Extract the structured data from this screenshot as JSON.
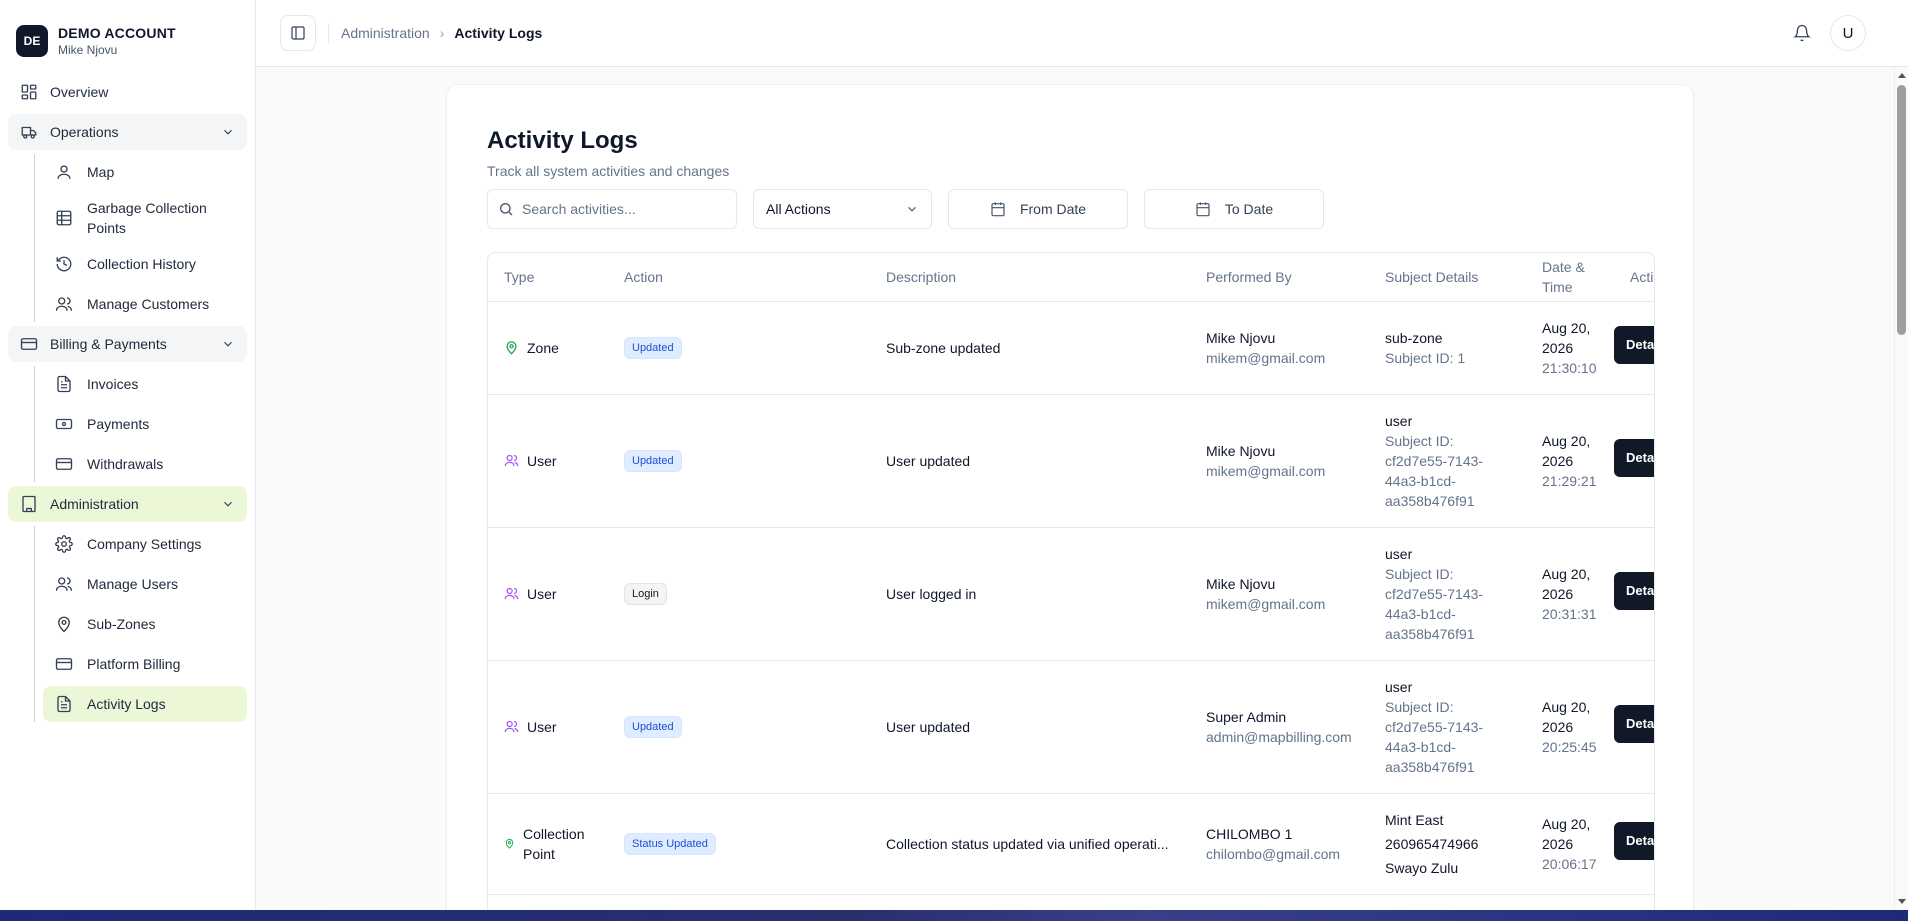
{
  "account": {
    "initials": "DE",
    "name": "DEMO ACCOUNT",
    "user": "Mike Njovu"
  },
  "nav": {
    "overview": "Overview",
    "operations": "Operations",
    "map": "Map",
    "gcp": "Garbage Collection Points",
    "collection_history": "Collection History",
    "manage_customers": "Manage Customers",
    "billing": "Billing & Payments",
    "invoices": "Invoices",
    "payments": "Payments",
    "withdrawals": "Withdrawals",
    "administration": "Administration",
    "company_settings": "Company Settings",
    "manage_users": "Manage Users",
    "sub_zones": "Sub-Zones",
    "platform_billing": "Platform Billing",
    "activity_logs": "Activity Logs"
  },
  "breadcrumb": {
    "parent": "Administration",
    "current": "Activity Logs"
  },
  "avatar": "U",
  "page": {
    "title": "Activity Logs",
    "subtitle": "Track all system activities and changes"
  },
  "filters": {
    "search_placeholder": "Search activities...",
    "actions_value": "All Actions",
    "from_date": "From Date",
    "to_date": "To Date"
  },
  "table": {
    "headers": {
      "type": "Type",
      "action": "Action",
      "description": "Description",
      "performed_by": "Performed By",
      "subject": "Subject Details",
      "datetime_1": "Date &",
      "datetime_2": "Time",
      "actions": "Actions"
    },
    "rows": [
      {
        "type": "Zone",
        "action": "Updated",
        "description": "Sub-zone updated",
        "name": "Mike Njovu",
        "email": "mikem@gmail.com",
        "subject_title": "sub-zone",
        "subject_lines": [
          "Subject ID: 1"
        ],
        "date_1": "Aug 20,",
        "date_2": "2026",
        "time": "21:30:10",
        "button": "Details"
      },
      {
        "type": "User",
        "action": "Updated",
        "description": "User updated",
        "name": "Mike Njovu",
        "email": "mikem@gmail.com",
        "subject_title": "user",
        "subject_lines": [
          "Subject ID:",
          "cf2d7e55-7143-",
          "44a3-b1cd-",
          "aa358b476f91"
        ],
        "date_1": "Aug 20,",
        "date_2": "2026",
        "time": "21:29:21",
        "button": "Details"
      },
      {
        "type": "User",
        "action": "Login",
        "description": "User logged in",
        "name": "Mike Njovu",
        "email": "mikem@gmail.com",
        "subject_title": "user",
        "subject_lines": [
          "Subject ID:",
          "cf2d7e55-7143-",
          "44a3-b1cd-",
          "aa358b476f91"
        ],
        "date_1": "Aug 20,",
        "date_2": "2026",
        "time": "20:31:31",
        "button": "Details"
      },
      {
        "type": "User",
        "action": "Updated",
        "description": "User updated",
        "name": "Super Admin",
        "email": "admin@mapbilling.com",
        "subject_title": "user",
        "subject_lines": [
          "Subject ID:",
          "cf2d7e55-7143-",
          "44a3-b1cd-",
          "aa358b476f91"
        ],
        "date_1": "Aug 20,",
        "date_2": "2026",
        "time": "20:25:45",
        "button": "Details"
      },
      {
        "type_1": "Collection",
        "type_2": "Point",
        "action": "Status Updated",
        "description": "Collection status updated via unified operati...",
        "name": "CHILOMBO 1",
        "email": "chilombo@gmail.com",
        "subject_title": "Mint East",
        "subject_lines": [
          "260965474966",
          "Swayo Zulu"
        ],
        "date_1": "Aug 20,",
        "date_2": "2026",
        "time": "20:06:17",
        "button": "Details"
      }
    ]
  }
}
